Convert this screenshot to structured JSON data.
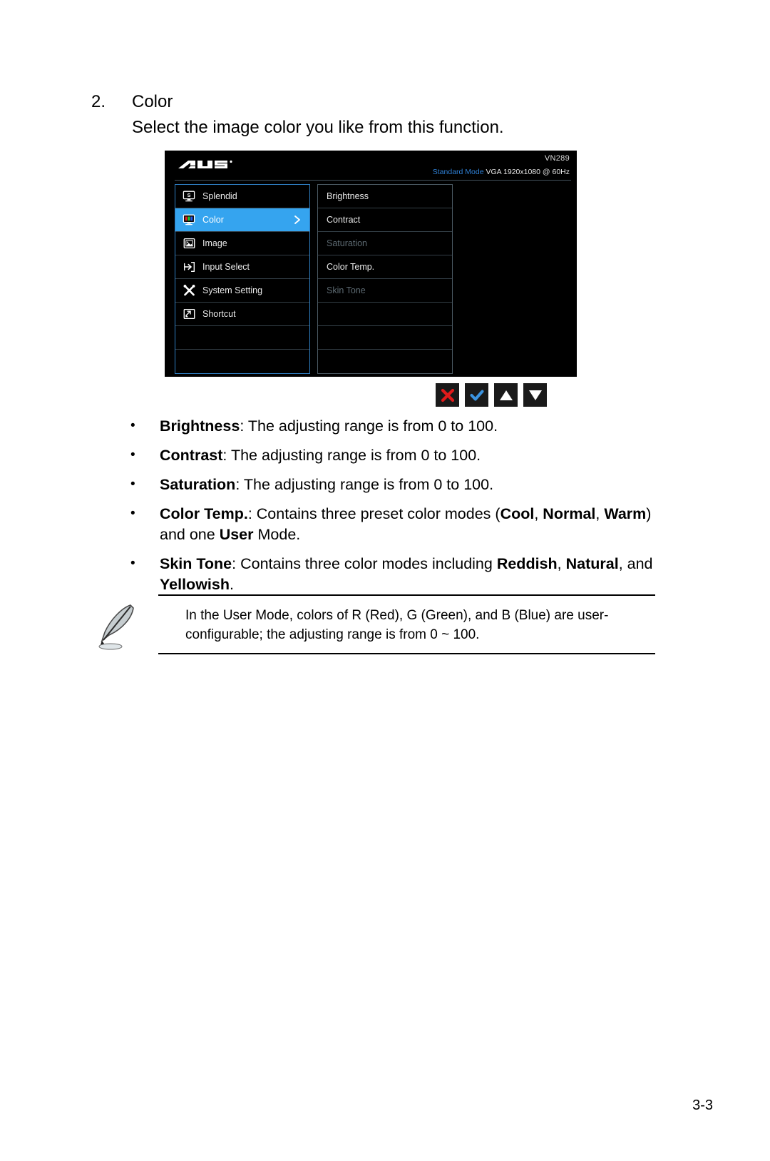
{
  "page": {
    "step_number": "2.",
    "step_title": "Color",
    "step_description": "Select the image color you like from this function.",
    "page_number": "3-3"
  },
  "osd": {
    "brand": "ASUS",
    "model": "VN289",
    "status_mode": "Standard Mode",
    "status_input": "VGA",
    "status_resolution": "1920x1080 @ 60Hz",
    "accent_color": "#35a4ef",
    "border_color": "#2f7fc4",
    "background_color": "#000000",
    "main_menu": [
      {
        "label": "Splendid",
        "icon": "splendid-monitor-icon",
        "state": "normal",
        "arrow": false
      },
      {
        "label": "Color",
        "icon": "color-rgb-monitor-icon",
        "state": "selected",
        "arrow": true
      },
      {
        "label": "Image",
        "icon": "image-picture-icon",
        "state": "normal",
        "arrow": false
      },
      {
        "label": "Input Select",
        "icon": "input-arrow-icon",
        "state": "normal",
        "arrow": false
      },
      {
        "label": "System Setting",
        "icon": "wrench-tools-icon",
        "state": "normal",
        "arrow": false
      },
      {
        "label": "Shortcut",
        "icon": "shortcut-icon",
        "state": "normal",
        "arrow": false
      },
      {
        "label": "",
        "icon": "",
        "state": "empty",
        "arrow": false
      },
      {
        "label": "",
        "icon": "",
        "state": "empty",
        "arrow": false
      }
    ],
    "sub_menu": [
      {
        "label": "Brightness",
        "state": "normal"
      },
      {
        "label": "Contract",
        "state": "normal"
      },
      {
        "label": "Saturation",
        "state": "disabled"
      },
      {
        "label": "Color Temp.",
        "state": "normal"
      },
      {
        "label": "Skin Tone",
        "state": "disabled"
      },
      {
        "label": "",
        "state": "empty"
      },
      {
        "label": "",
        "state": "empty"
      },
      {
        "label": "",
        "state": "empty"
      }
    ],
    "buttons": [
      {
        "name": "close-button",
        "icon": "close-x-icon",
        "color": "#e01b1b"
      },
      {
        "name": "confirm-button",
        "icon": "check-mark-icon",
        "color": "#3b93e0"
      },
      {
        "name": "up-button",
        "icon": "triangle-up-icon",
        "color": "#ffffff"
      },
      {
        "name": "down-button",
        "icon": "triangle-down-icon",
        "color": "#ffffff"
      }
    ]
  },
  "bullets": [
    {
      "term": "Brightness",
      "rest": ": The adjusting range is from 0 to 100."
    },
    {
      "term": "Contrast",
      "rest": ": The adjusting range is from 0 to 100."
    },
    {
      "term": "Saturation",
      "rest": ": The adjusting range is from 0 to 100."
    },
    {
      "term": "Color Temp.",
      "rest": ": Contains three preset color modes (",
      "emphasis": [
        "Cool",
        "Normal",
        "Warm"
      ],
      "tail": ") and one ",
      "tail_bold": "User",
      "tail_end": " Mode."
    },
    {
      "term": "Skin Tone",
      "rest": ": Contains three color modes including ",
      "emphasis": [
        "Reddish",
        "Natural"
      ],
      "tail": ", and ",
      "tail_bold": "Yellowish",
      "tail_end": "."
    }
  ],
  "note": {
    "icon": "quill-pen-icon",
    "line1": "In the User Mode, colors of R (Red), G (Green), and B (Blue) are user-",
    "line2": "configurable; the adjusting range is from 0 ~ 100."
  }
}
